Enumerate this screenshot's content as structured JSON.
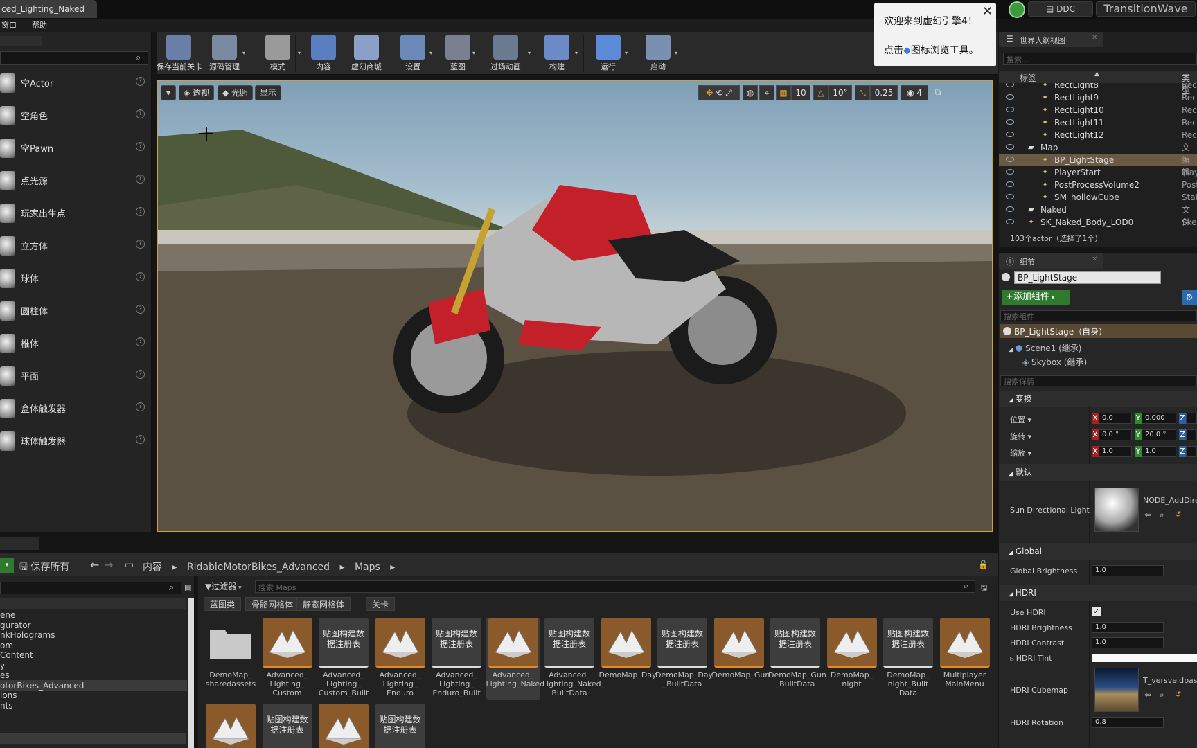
{
  "window": {
    "doc_tab": "ced_Lighting_Naked"
  },
  "menus": [
    "窗口",
    "帮助"
  ],
  "top_right": {
    "ddc": "DDC",
    "brand": "TransitionWave"
  },
  "welcome": {
    "line1": "欢迎来到虚幻引擎4！",
    "line2a": "点击",
    "line2b": "图标浏览工具。"
  },
  "place_items": [
    "空Actor",
    "空角色",
    "空Pawn",
    "点光源",
    "玩家出生点",
    "立方体",
    "球体",
    "圆柱体",
    "椎体",
    "平面",
    "盒体触发器",
    "球体触发器"
  ],
  "toolbar": [
    {
      "label": "保存当前关卡",
      "icon": "save-icon"
    },
    {
      "label": "源码管理",
      "icon": "source-control-icon"
    },
    {
      "label": "模式",
      "icon": "modes-icon"
    },
    {
      "label": "内容",
      "icon": "content-icon"
    },
    {
      "label": "虚幻商城",
      "icon": "marketplace-icon"
    },
    {
      "label": "设置",
      "icon": "settings-icon"
    },
    {
      "label": "蓝图",
      "icon": "blueprint-icon"
    },
    {
      "label": "过场动画",
      "icon": "cinematics-icon"
    },
    {
      "label": "构建",
      "icon": "build-icon"
    },
    {
      "label": "运行",
      "icon": "play-icon"
    },
    {
      "label": "启动",
      "icon": "launch-icon"
    }
  ],
  "viewport": {
    "chips": [
      "透视",
      "光照",
      "显示"
    ],
    "grid": "10",
    "rot": "10°",
    "scale": "0.25",
    "cam_speed": "4"
  },
  "outliner": {
    "title": "世界大纲视图",
    "search_placeholder": "搜索...",
    "col_label": "标签",
    "col_type": "类型",
    "rows": [
      {
        "name": "RectLight8",
        "type": "Rect"
      },
      {
        "name": "RectLight9",
        "type": "Rect"
      },
      {
        "name": "RectLight10",
        "type": "Rect"
      },
      {
        "name": "RectLight11",
        "type": "Rect"
      },
      {
        "name": "RectLight12",
        "type": "Rect"
      },
      {
        "name": "Map",
        "type": "文件"
      },
      {
        "name": "BP_LightStage",
        "type": "编辑"
      },
      {
        "name": "PlayerStart",
        "type": "Play"
      },
      {
        "name": "PostProcessVolume2",
        "type": "Post"
      },
      {
        "name": "SM_hollowCube",
        "type": "Stati"
      },
      {
        "name": "Naked",
        "type": "文件"
      },
      {
        "name": "SK_Naked_Body_LOD0",
        "type": "Skele"
      }
    ],
    "footer": "103个actor（选择了1个）"
  },
  "details": {
    "title": "细节",
    "object_name": "BP_LightStage",
    "add_component": "+添加组件",
    "search_components": "搜索组件",
    "self_row": "BP_LightStage（自身）",
    "components": [
      "Scene1 (继承)",
      "Skybox (继承)"
    ],
    "search_details": "搜索详情",
    "transform": "变换",
    "location": "位置",
    "rotation": "旋转",
    "scale": "缩放",
    "loc_x": "0.0",
    "loc_y": "0.000",
    "rot_x": "0.0 °",
    "rot_y": "20.0 °",
    "scl_x": "1.0",
    "scl_y": "1.0",
    "default": "默认",
    "sun_label": "Sun Directional Light",
    "sun_value": "NODE_AddDirec",
    "global": "Global",
    "global_brightness": "Global Brightness",
    "global_brightness_val": "1.0",
    "hdri": "HDRI",
    "use_hdri": "Use HDRI",
    "hdri_brightness": "HDRI Brightness",
    "hdri_brightness_val": "1.0",
    "hdri_contrast": "HDRI Contrast",
    "hdri_contrast_val": "1.0",
    "hdri_tint": "HDRI Tint",
    "hdri_cubemap": "HDRI Cubemap",
    "hdri_cubemap_val": "T_versveldpas_",
    "hdri_rotation": "HDRI Rotation",
    "hdri_rotation_val": "0.8"
  },
  "content_browser": {
    "save_all": "保存所有",
    "path": [
      "内容",
      "RidableMotorBikes_Advanced",
      "Maps"
    ],
    "filter": "过滤器",
    "search_placeholder": "搜索 Maps",
    "filter_chips": [
      "蓝图类",
      "骨骼网格体",
      "静态网格体",
      "关卡"
    ],
    "tree": [
      "ene",
      "gurator",
      "nkHolograms",
      "om",
      "Content",
      "y",
      "es",
      "otorBikes_Advanced",
      "ions",
      "nts"
    ],
    "assets": [
      {
        "name": "DemoMap_\nsharedassets",
        "kind": "folder"
      },
      {
        "name": "Advanced_\nLighting_\nCustom",
        "kind": "map"
      },
      {
        "name": "Advanced_\nLighting_\nCustom_Built",
        "kind": "data"
      },
      {
        "name": "Advanced_\nLighting_\nEnduro",
        "kind": "map"
      },
      {
        "name": "Advanced_\nLighting_\nEnduro_Built",
        "kind": "data"
      },
      {
        "name": "Advanced_\nLighting_Naked",
        "kind": "map-selected"
      },
      {
        "name": "Advanced_\nLighting_Naked_\nBuiltData",
        "kind": "data"
      },
      {
        "name": "DemoMap_Day",
        "kind": "map"
      },
      {
        "name": "DemoMap_Day\n_BuiltData",
        "kind": "data"
      },
      {
        "name": "DemoMap_Gun",
        "kind": "map"
      },
      {
        "name": "DemoMap_Gun\n_BuiltData",
        "kind": "data"
      },
      {
        "name": "DemoMap_\nnight",
        "kind": "map"
      },
      {
        "name": "DemoMap_\nnight_Built\nData",
        "kind": "data"
      },
      {
        "name": "Multiplayer\nMainMenu",
        "kind": "map"
      }
    ],
    "data_thumb_text": "贴图构建数据注册表"
  }
}
